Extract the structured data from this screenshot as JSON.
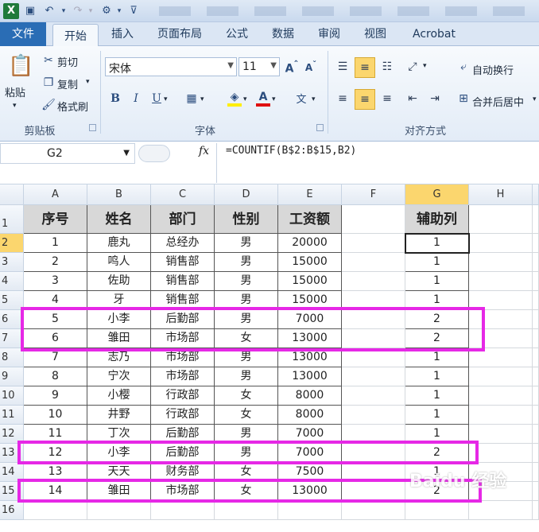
{
  "titlebar": {
    "logo": "X",
    "undo_icon": "undo-icon",
    "redo_icon": "redo-icon"
  },
  "tabs": [
    "文件",
    "开始",
    "插入",
    "页面布局",
    "公式",
    "数据",
    "审阅",
    "视图",
    "Acrobat"
  ],
  "ribbon": {
    "clipboard": {
      "paste": "粘贴",
      "cut": "剪切",
      "copy": "复制",
      "format_painter": "格式刷",
      "label": "剪贴板"
    },
    "font": {
      "name": "宋体",
      "size": "11",
      "label": "字体",
      "bold": "B",
      "italic": "I",
      "underline": "U"
    },
    "alignment": {
      "wrap": "自动换行",
      "merge": "合并后居中",
      "label": "对齐方式"
    }
  },
  "formula_bar": {
    "name_box": "G2",
    "fx": "fx",
    "formula": "=COUNTIF(B$2:B$15,B2)"
  },
  "columns": [
    "A",
    "B",
    "C",
    "D",
    "E",
    "F",
    "G",
    "H"
  ],
  "rows": [
    "1",
    "2",
    "3",
    "4",
    "5",
    "6",
    "7",
    "8",
    "9",
    "10",
    "11",
    "12",
    "13",
    "14",
    "15",
    "16"
  ],
  "table": {
    "headers": [
      "序号",
      "姓名",
      "部门",
      "性别",
      "工资额"
    ],
    "helper_header": "辅助列",
    "rows": [
      [
        "1",
        "鹿丸",
        "总经办",
        "男",
        "20000",
        "1"
      ],
      [
        "2",
        "鸣人",
        "销售部",
        "男",
        "15000",
        "1"
      ],
      [
        "3",
        "佐助",
        "销售部",
        "男",
        "15000",
        "1"
      ],
      [
        "4",
        "牙",
        "销售部",
        "男",
        "15000",
        "1"
      ],
      [
        "5",
        "小李",
        "后勤部",
        "男",
        "7000",
        "2"
      ],
      [
        "6",
        "雏田",
        "市场部",
        "女",
        "13000",
        "2"
      ],
      [
        "7",
        "志乃",
        "市场部",
        "男",
        "13000",
        "1"
      ],
      [
        "8",
        "宁次",
        "市场部",
        "男",
        "13000",
        "1"
      ],
      [
        "9",
        "小樱",
        "行政部",
        "女",
        "8000",
        "1"
      ],
      [
        "10",
        "井野",
        "行政部",
        "女",
        "8000",
        "1"
      ],
      [
        "11",
        "丁次",
        "后勤部",
        "男",
        "7000",
        "1"
      ],
      [
        "12",
        "小李",
        "后勤部",
        "男",
        "7000",
        "2"
      ],
      [
        "13",
        "天天",
        "财务部",
        "女",
        "7500",
        "1"
      ],
      [
        "14",
        "雏田",
        "市场部",
        "女",
        "13000",
        "2"
      ]
    ]
  },
  "watermark": "Baidu 经验",
  "colors": {
    "highlight": "#e628e6",
    "selected_header": "#fbd66e",
    "file_tab": "#2a6db5"
  }
}
